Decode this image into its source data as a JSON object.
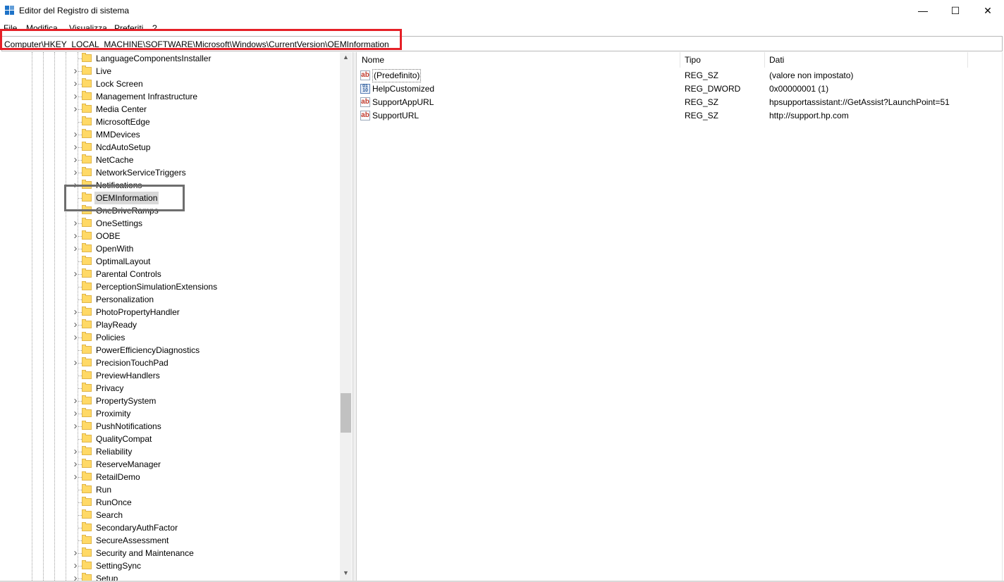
{
  "window": {
    "title": "Editor del Registro di sistema",
    "controls": {
      "minimize": "—",
      "maximize": "☐",
      "close": "✕"
    }
  },
  "menu": [
    "File",
    "Modifica",
    "Visualizza",
    "Preferiti",
    "?"
  ],
  "address": "Computer\\HKEY_LOCAL_MACHINE\\SOFTWARE\\Microsoft\\Windows\\CurrentVersion\\OEMInformation",
  "colors": {
    "address_highlight": "#e52027",
    "selection_box": "#6e6e6e",
    "folder": "#ffd966",
    "selected_bg": "#d9d9d9"
  },
  "tree": {
    "items": [
      {
        "label": "LanguageComponentsInstaller",
        "expandable": false
      },
      {
        "label": "Live",
        "expandable": true
      },
      {
        "label": "Lock Screen",
        "expandable": true
      },
      {
        "label": "Management Infrastructure",
        "expandable": true
      },
      {
        "label": "Media Center",
        "expandable": true
      },
      {
        "label": "MicrosoftEdge",
        "expandable": false
      },
      {
        "label": "MMDevices",
        "expandable": true
      },
      {
        "label": "NcdAutoSetup",
        "expandable": true
      },
      {
        "label": "NetCache",
        "expandable": true
      },
      {
        "label": "NetworkServiceTriggers",
        "expandable": true
      },
      {
        "label": "Notifications",
        "expandable": true
      },
      {
        "label": "OEMInformation",
        "expandable": false,
        "selected": true
      },
      {
        "label": "OneDriveRamps",
        "expandable": false
      },
      {
        "label": "OneSettings",
        "expandable": true
      },
      {
        "label": "OOBE",
        "expandable": true
      },
      {
        "label": "OpenWith",
        "expandable": true
      },
      {
        "label": "OptimalLayout",
        "expandable": false
      },
      {
        "label": "Parental Controls",
        "expandable": true
      },
      {
        "label": "PerceptionSimulationExtensions",
        "expandable": false
      },
      {
        "label": "Personalization",
        "expandable": false
      },
      {
        "label": "PhotoPropertyHandler",
        "expandable": true
      },
      {
        "label": "PlayReady",
        "expandable": true
      },
      {
        "label": "Policies",
        "expandable": true
      },
      {
        "label": "PowerEfficiencyDiagnostics",
        "expandable": false
      },
      {
        "label": "PrecisionTouchPad",
        "expandable": true
      },
      {
        "label": "PreviewHandlers",
        "expandable": false
      },
      {
        "label": "Privacy",
        "expandable": false
      },
      {
        "label": "PropertySystem",
        "expandable": true
      },
      {
        "label": "Proximity",
        "expandable": true
      },
      {
        "label": "PushNotifications",
        "expandable": true
      },
      {
        "label": "QualityCompat",
        "expandable": false
      },
      {
        "label": "Reliability",
        "expandable": true
      },
      {
        "label": "ReserveManager",
        "expandable": true
      },
      {
        "label": "RetailDemo",
        "expandable": true
      },
      {
        "label": "Run",
        "expandable": false
      },
      {
        "label": "RunOnce",
        "expandable": false
      },
      {
        "label": "Search",
        "expandable": false
      },
      {
        "label": "SecondaryAuthFactor",
        "expandable": false
      },
      {
        "label": "SecureAssessment",
        "expandable": false
      },
      {
        "label": "Security and Maintenance",
        "expandable": true
      },
      {
        "label": "SettingSync",
        "expandable": true
      },
      {
        "label": "Setup",
        "expandable": true
      }
    ]
  },
  "scrollbar": {
    "position_fraction": 0.71
  },
  "values": {
    "headers": {
      "name": "Nome",
      "type": "Tipo",
      "data": "Dati"
    },
    "rows": [
      {
        "name": "(Predefinito)",
        "type": "REG_SZ",
        "data": "(valore non impostato)",
        "icon": "string-value-icon",
        "focused": true
      },
      {
        "name": "HelpCustomized",
        "type": "REG_DWORD",
        "data": "0x00000001 (1)",
        "icon": "dword-value-icon"
      },
      {
        "name": "SupportAppURL",
        "type": "REG_SZ",
        "data": "hpsupportassistant://GetAssist?LaunchPoint=51",
        "icon": "string-value-icon"
      },
      {
        "name": "SupportURL",
        "type": "REG_SZ",
        "data": "http://support.hp.com",
        "icon": "string-value-icon"
      }
    ]
  }
}
